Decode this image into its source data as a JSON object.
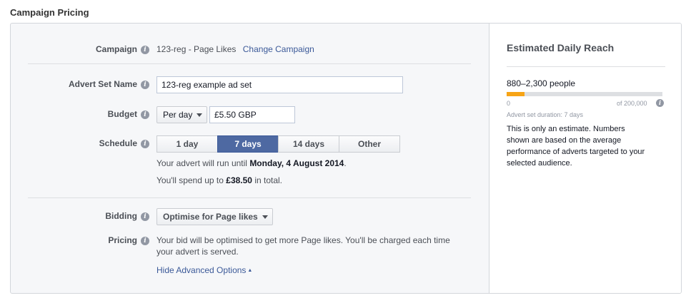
{
  "section_title": "Campaign Pricing",
  "campaign": {
    "label": "Campaign",
    "value": "123-reg - Page Likes",
    "change_link": "Change Campaign"
  },
  "advert_set": {
    "label": "Advert Set Name",
    "value": "123-reg example ad set"
  },
  "budget": {
    "label": "Budget",
    "type_selected": "Per day",
    "amount": "£5.50 GBP"
  },
  "schedule": {
    "label": "Schedule",
    "options": [
      "1 day",
      "7 days",
      "14 days",
      "Other"
    ],
    "selected": "7 days",
    "run_until_prefix": "Your advert will run until",
    "run_until_date": "Monday, 4 August 2014",
    "run_until_suffix": ".",
    "spend_prefix": "You'll spend up to",
    "spend_amount": "£38.50",
    "spend_suffix": "in total."
  },
  "bidding": {
    "label": "Bidding",
    "selected": "Optimise for Page likes"
  },
  "pricing": {
    "label": "Pricing",
    "line1": "Your bid will be optimised to get more Page likes. You'll be charged each time",
    "line2": "your advert is served.",
    "hide_advanced": "Hide Advanced Options",
    "hide_advanced_arrow": "▲"
  },
  "reach": {
    "title": "Estimated Daily Reach",
    "people": "880–2,300 people",
    "bar_fraction": 0.115,
    "bar_color": "#f7a416",
    "axis_min": "0",
    "axis_max": "of 200,000",
    "duration": "Advert set duration: 7 days",
    "note_lines": [
      "This is only an estimate. Numbers",
      "shown are based on the average",
      "performance of adverts targeted to your",
      "selected audience."
    ]
  },
  "icons": {
    "info": "info-icon",
    "dropdown": "chevron-down-icon"
  },
  "accent_color": "#3b5998"
}
